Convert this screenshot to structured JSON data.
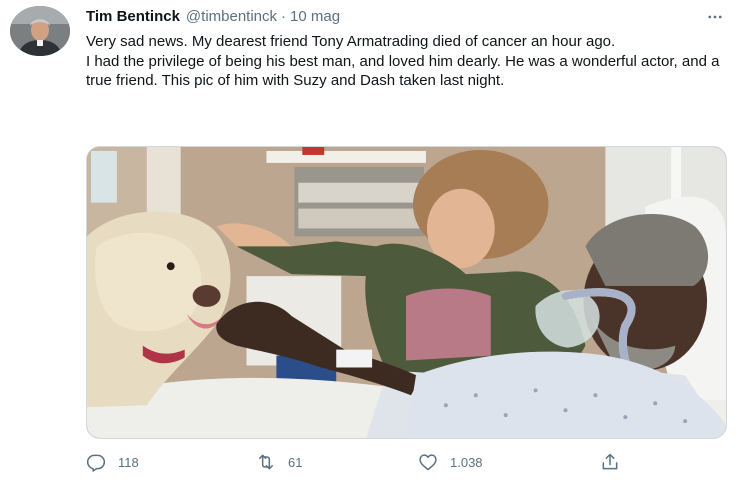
{
  "colors": {
    "text_primary": "#0f1419",
    "text_secondary": "#5b7083",
    "border": "#cfd9de"
  },
  "tweet": {
    "author": {
      "display_name": "Tim Bentinck",
      "handle": "@timbentinck",
      "separator": "·",
      "timestamp": "10 mag"
    },
    "more_icon": "more-horizontal-icon",
    "text": {
      "line1": "Very sad news. My dearest friend Tony Armatrading died of cancer an hour ago.",
      "line2": "I had the privilege of being his best man, and loved him dearly. He was a wonderful actor, and a true friend. This pic of him with Suzy and Dash taken last night."
    },
    "actions": {
      "reply": {
        "icon": "reply-icon",
        "count": "118"
      },
      "retweet": {
        "icon": "retweet-icon",
        "count": "61"
      },
      "like": {
        "icon": "heart-icon",
        "count": "1.038"
      },
      "share": {
        "icon": "share-icon"
      }
    }
  }
}
